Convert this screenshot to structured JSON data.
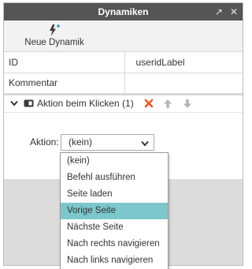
{
  "panel": {
    "title": "Dynamiken"
  },
  "titlebar": {
    "popout_glyph": "↗",
    "close_glyph": "✕"
  },
  "toolbar": {
    "new_dynamic_label": "Neue Dynamik",
    "new_dynamic_icon": "lightning-plus-icon"
  },
  "properties": [
    {
      "key": "ID",
      "value": "useridLabel"
    },
    {
      "key": "Kommentar",
      "value": ""
    }
  ],
  "dynamic": {
    "label": "Aktion beim Klicken (1)",
    "expanded": true,
    "event_icon": "click-event-icon",
    "delete_icon": "delete-x-icon",
    "up_icon": "move-up-icon",
    "down_icon": "move-down-icon",
    "colors": {
      "delete": "#e8572a",
      "arrows": "#b5b5b5"
    }
  },
  "action": {
    "label": "Aktion:",
    "selected": "(kein)",
    "options": [
      "(kein)",
      "Befehl ausführen",
      "Seite laden",
      "Vorige Seite",
      "Nächste Seite",
      "Nach rechts navigieren",
      "Nach links navigieren"
    ],
    "highlighted_option": "Vorige Seite"
  },
  "colors": {
    "titlebar": "#555555",
    "toolbar": "#f2f2f2",
    "highlight": "#7cc7cb",
    "lower_area": "#dcdcdc"
  }
}
